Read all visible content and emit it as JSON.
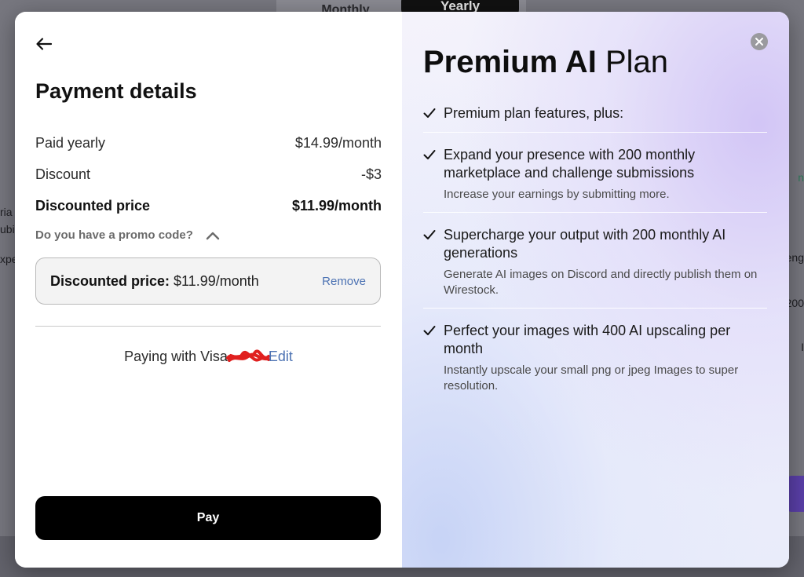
{
  "background": {
    "tabs": {
      "monthly": "Monthly",
      "yearly": "Yearly"
    },
    "left_fragments": [
      "ria",
      "ubi",
      "xpe"
    ],
    "right_fragments": [
      "n",
      "eng",
      "200",
      "I"
    ]
  },
  "payment": {
    "title": "Payment details",
    "rows": [
      {
        "label": "Paid yearly",
        "value": "$14.99/month"
      },
      {
        "label": "Discount",
        "value": "-$3"
      },
      {
        "label": "Discounted price",
        "value": "$11.99/month"
      }
    ],
    "promo_question": "Do you have a promo code?",
    "promo_box": {
      "label": "Discounted price:",
      "value": "$11.99/month",
      "remove": "Remove"
    },
    "paying_with": "Paying with Visa",
    "edit": "Edit",
    "pay_button": "Pay"
  },
  "plan": {
    "title_bold": "Premium AI",
    "title_regular": "Plan",
    "features": [
      {
        "title": "Premium plan features, plus:",
        "desc": ""
      },
      {
        "title": "Expand your presence with 200 monthly marketplace and challenge submissions",
        "desc": "Increase your earnings by submitting more."
      },
      {
        "title": "Supercharge your output with 200 monthly AI generations",
        "desc": "Generate AI images on Discord and directly publish them on Wirestock."
      },
      {
        "title": "Perfect your images with 400 AI upscaling per month",
        "desc": "Instantly upscale your small png or jpeg Images to super resolution."
      }
    ]
  },
  "icons": {
    "back": "arrow-left-icon",
    "close": "close-icon",
    "check": "check-icon",
    "chevron": "chevron-up-icon"
  },
  "colors": {
    "link": "#4c72b3",
    "pay_button": "#000000",
    "redaction": "#e0201f"
  }
}
